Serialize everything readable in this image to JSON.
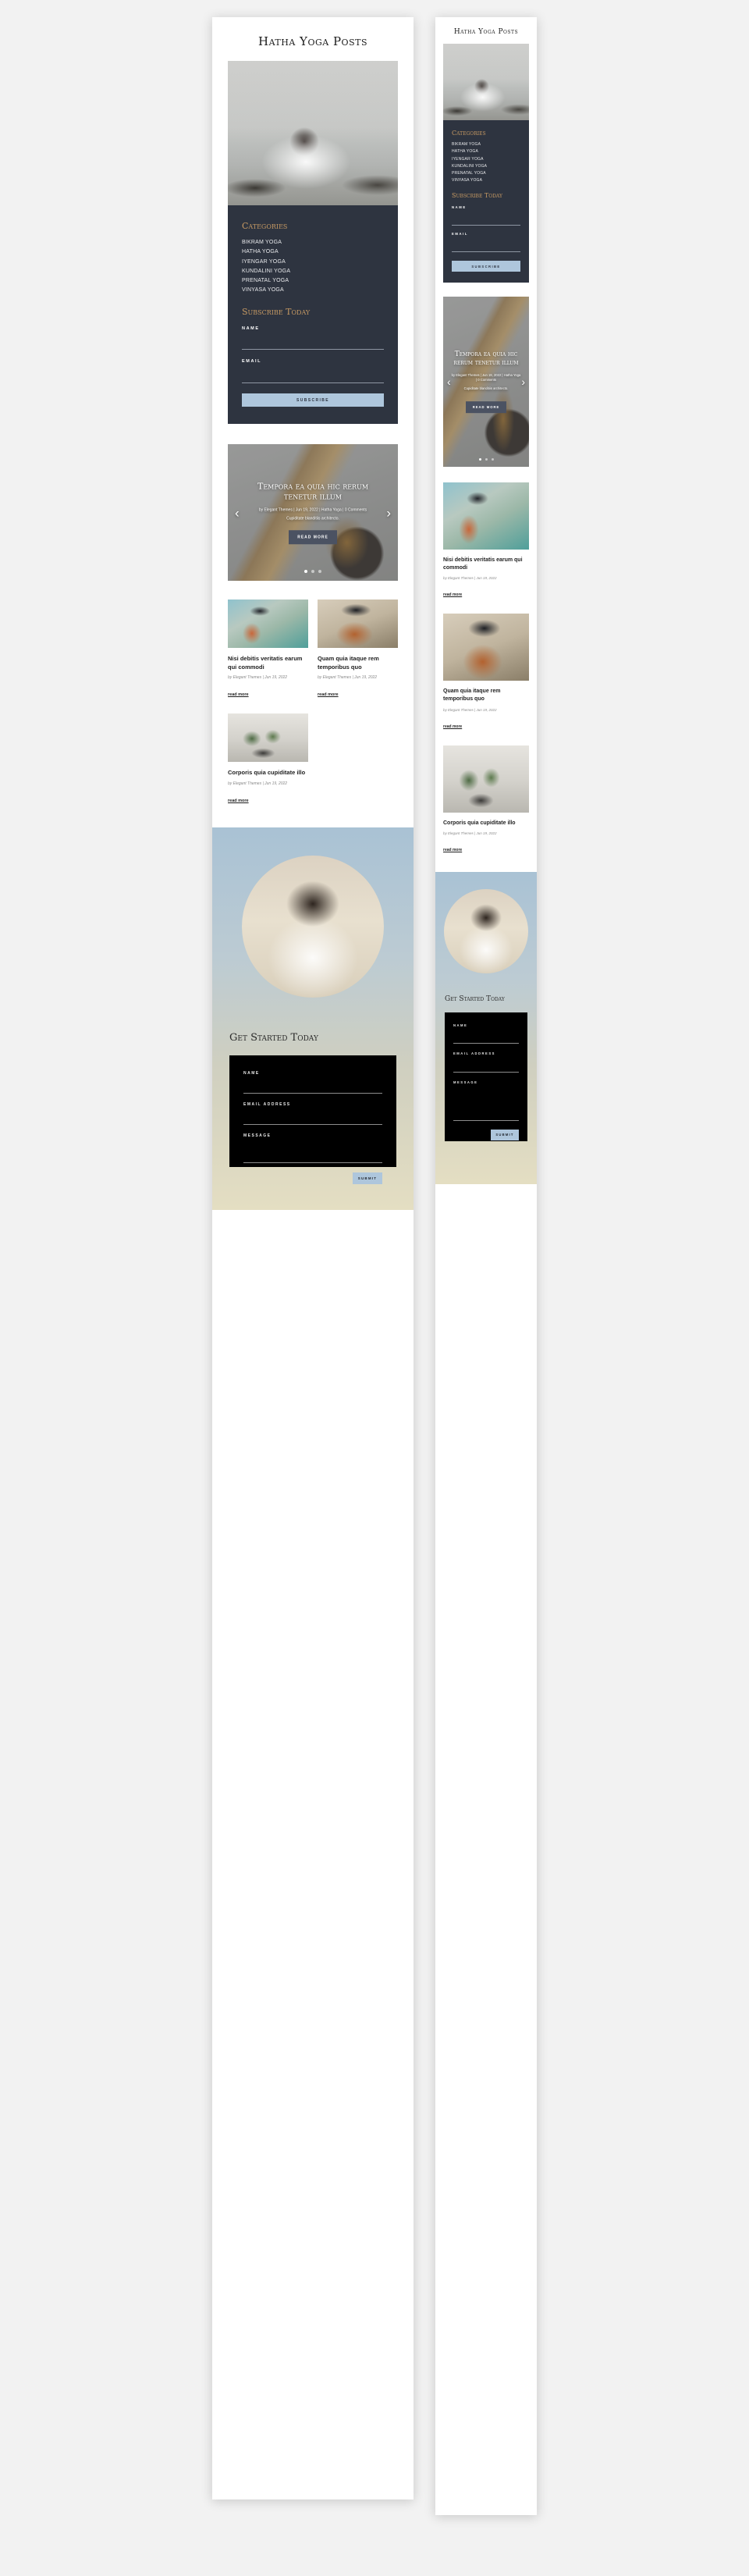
{
  "page": {
    "title": "Hatha Yoga Posts",
    "background_color": "#f2f2f2"
  },
  "sidebar": {
    "categories_heading": "Categories",
    "categories": [
      "BIKRAM YOGA",
      "HATHA YOGA",
      "IYENGAR YOGA",
      "KUNDALINI YOGA",
      "PRENATAL YOGA",
      "VINYASA YOGA"
    ],
    "subscribe_heading": "Subscribe Today",
    "name_label": "NAME",
    "name_value": "",
    "email_label": "EMAIL",
    "email_value": "",
    "subscribe_button": "SUBSCRIBE",
    "panel_color": "#2e3440",
    "accent_color": "#c79a63",
    "button_color": "#aec6dc"
  },
  "slider": {
    "title": "Tempora ea quia hic rerum tenetur illum",
    "meta": "by Elegant Themes | Jun 19, 2022 | Hatha Yoga | 0 Comments",
    "excerpt": "Cupiditate blanditiis architecto.",
    "button": "READ MORE",
    "prev_icon": "chevron-left-icon",
    "next_icon": "chevron-right-icon",
    "dots": 3,
    "active_dot": 0
  },
  "posts": [
    {
      "title": "Nisi debitis veritatis earum qui commodi",
      "meta": "by Elegant Themes | Jun 19, 2022",
      "read_more": "read more",
      "image": "woman-with-hat-reading-by-boats"
    },
    {
      "title": "Quam quia itaque rem temporibus quo",
      "meta": "by Elegant Themes | Jun 19, 2022",
      "read_more": "read more",
      "image": "woman-with-hat-smiling"
    },
    {
      "title": "Corporis quia cupiditate illo",
      "meta": "by Elegant Themes | Jun 19, 2022",
      "read_more": "read more",
      "image": "potted-cactus-plants"
    }
  ],
  "cta": {
    "heading": "Get Started Today",
    "name_label": "NAME",
    "name_value": "",
    "email_label": "EMAIL ADDRESS",
    "email_value": "",
    "message_label": "MESSAGE",
    "message_value": "",
    "submit_button": "SUBMIT",
    "card_color": "#000000",
    "button_color": "#aec6dc"
  },
  "viewports": {
    "tablet_label": "tablet-preview",
    "mobile_label": "mobile-preview"
  }
}
